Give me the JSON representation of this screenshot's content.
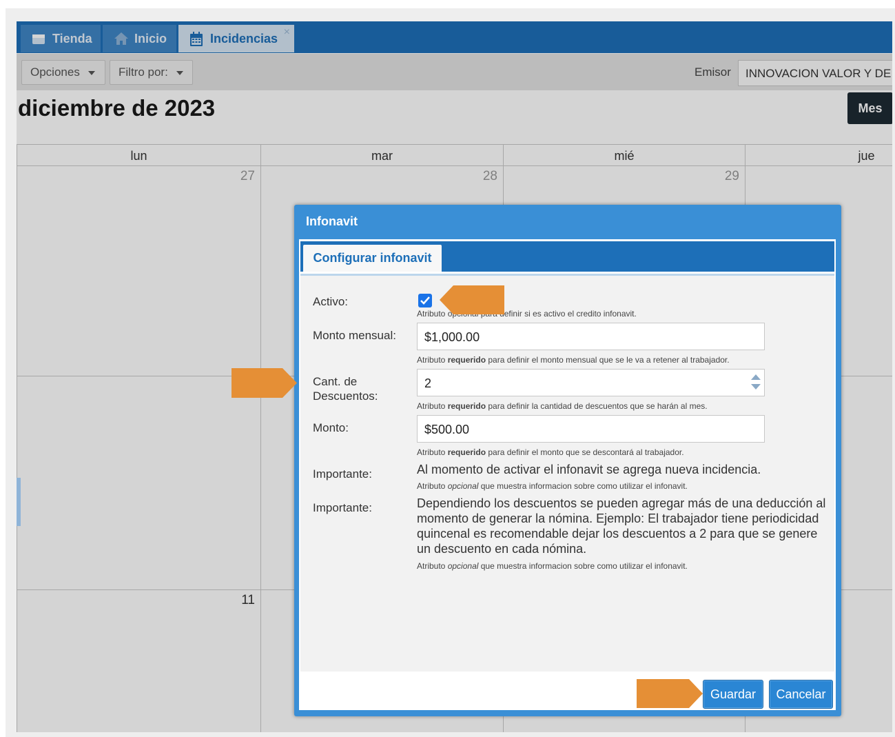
{
  "tabs": [
    {
      "label": "Tienda",
      "icon": "store-icon"
    },
    {
      "label": "Inicio",
      "icon": "home-icon"
    },
    {
      "label": "Incidencias",
      "icon": "calendar-icon",
      "active": true,
      "close_glyph": "×"
    }
  ],
  "toolbar": {
    "opciones_label": "Opciones",
    "filtro_label": "Filtro por:",
    "emisor_label": "Emisor",
    "emisor_value": "INNOVACION VALOR Y DE"
  },
  "calendar": {
    "title": "diciembre de 2023",
    "view_button": "Mes",
    "day_headers": [
      "lun",
      "mar",
      "mié",
      "jue"
    ],
    "week1_days": [
      "27",
      "28",
      "29"
    ],
    "week3_days": [
      "11"
    ]
  },
  "dialog": {
    "title": "Infonavit",
    "tab_label": "Configurar infonavit",
    "activo": {
      "label": "Activo:",
      "checked": true,
      "hint": "Atributo opcional para definir si es activo el credito infonavit."
    },
    "monto_mensual": {
      "label": "Monto mensual:",
      "value": "$1,000.00",
      "hint_pre": "Atributo ",
      "hint_bold": "requerido",
      "hint_post": " para definir el monto mensual que se le va a retener al trabajador."
    },
    "cant_descuentos": {
      "label": "Cant. de Descuentos:",
      "value": "2",
      "hint_pre": "Atributo ",
      "hint_bold": "requerido",
      "hint_post": " para definir la cantidad de descuentos que se harán al mes."
    },
    "monto": {
      "label": "Monto:",
      "value": "$500.00",
      "hint_pre": "Atributo ",
      "hint_bold": "requerido",
      "hint_post": " para definir el monto que se descontará al trabajador."
    },
    "importante1": {
      "label": "Importante:",
      "text": "Al momento de activar el infonavit se agrega nueva incidencia.",
      "hint_pre": "Atributo ",
      "hint_italic": "opcional",
      "hint_post": " que muestra informacion sobre como utilizar el infonavit."
    },
    "importante2": {
      "label": "Importante:",
      "text": "Dependiendo los descuentos se pueden agregar más de una deducción al momento de generar la nómina. Ejemplo: El trabajador tiene periodicidad quincenal es recomendable dejar los descuentos a 2 para que se genere un descuento en cada nómina.",
      "hint_pre": "Atributo ",
      "hint_italic": "opcional",
      "hint_post": " que muestra informacion sobre como utilizar el infonavit."
    },
    "save_label": "Guardar",
    "cancel_label": "Cancelar"
  },
  "colors": {
    "brand_blue": "#1d6fb8",
    "dialog_blue": "#3a8fd6",
    "annotation_orange": "#e58f36",
    "dark_button": "#1e2b33"
  }
}
